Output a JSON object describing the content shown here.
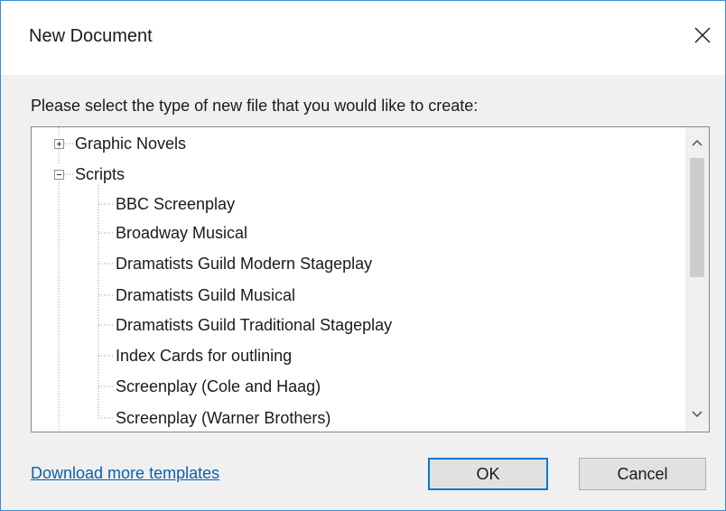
{
  "dialog": {
    "title": "New Document",
    "prompt": "Please select the type of new file that you would like to create:"
  },
  "tree": {
    "categories": [
      {
        "label": "Graphic Novels",
        "expanded": false
      },
      {
        "label": "Scripts",
        "expanded": true
      }
    ],
    "children": [
      "BBC Screenplay",
      "Broadway Musical",
      "Dramatists Guild Modern Stageplay",
      "Dramatists Guild Musical",
      "Dramatists Guild Traditional Stageplay",
      "Index Cards for outlining",
      "Screenplay (Cole and Haag)",
      "Screenplay (Warner Brothers)"
    ]
  },
  "footer": {
    "link_label": "Download more templates",
    "ok_label": "OK",
    "cancel_label": "Cancel"
  },
  "icons": {
    "close": "close-icon",
    "expand": "plus-box-icon",
    "collapse": "minus-box-icon",
    "scroll_up": "chevron-up-icon",
    "scroll_down": "chevron-down-icon"
  },
  "colors": {
    "accent": "#0078d7",
    "link": "#0b5fb0",
    "window_border": "#3b8ad6"
  }
}
